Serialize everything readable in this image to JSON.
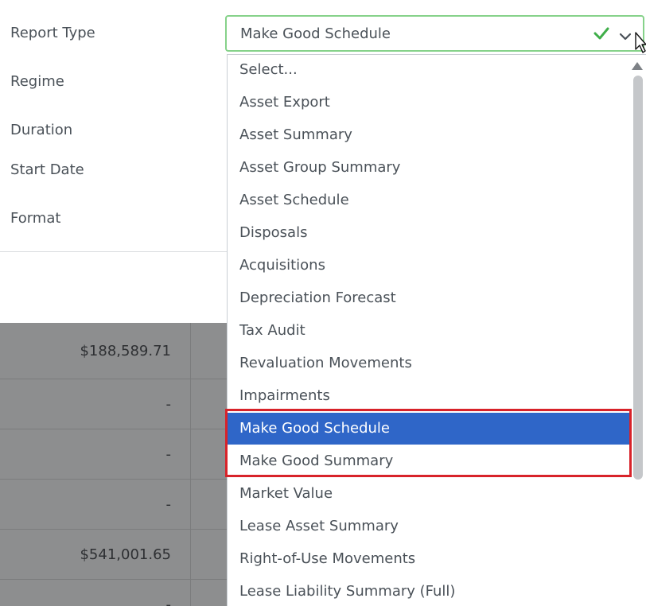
{
  "form": {
    "labels": [
      "Report Type",
      "Regime",
      "Duration",
      "Start Date",
      "Format"
    ]
  },
  "report_type_select": {
    "value": "Make Good Schedule",
    "valid": true,
    "icons": [
      "check-icon",
      "chevron-down-icon"
    ]
  },
  "dropdown": {
    "options": [
      "Select...",
      "Asset Export",
      "Asset Summary",
      "Asset Group Summary",
      "Asset Schedule",
      "Disposals",
      "Acquisitions",
      "Depreciation Forecast",
      "Tax Audit",
      "Revaluation Movements",
      "Impairments",
      "Make Good Schedule",
      "Make Good Summary",
      "Market Value",
      "Lease Asset Summary",
      "Right-of-Use Movements",
      "Lease Liability Summary (Full)"
    ],
    "selected_option": "Make Good Schedule",
    "highlighted_options": [
      "Make Good Schedule",
      "Make Good Summary"
    ]
  },
  "background_table": {
    "values": [
      "$188,589.71",
      "-",
      "-",
      "-",
      "$541,001.65",
      "-"
    ]
  },
  "colors": {
    "selected_bg": "#2f66c8",
    "valid_border": "#86d28a",
    "check": "#3fae49",
    "highlight": "#d8232a",
    "overlay": "#8d8e8f"
  }
}
